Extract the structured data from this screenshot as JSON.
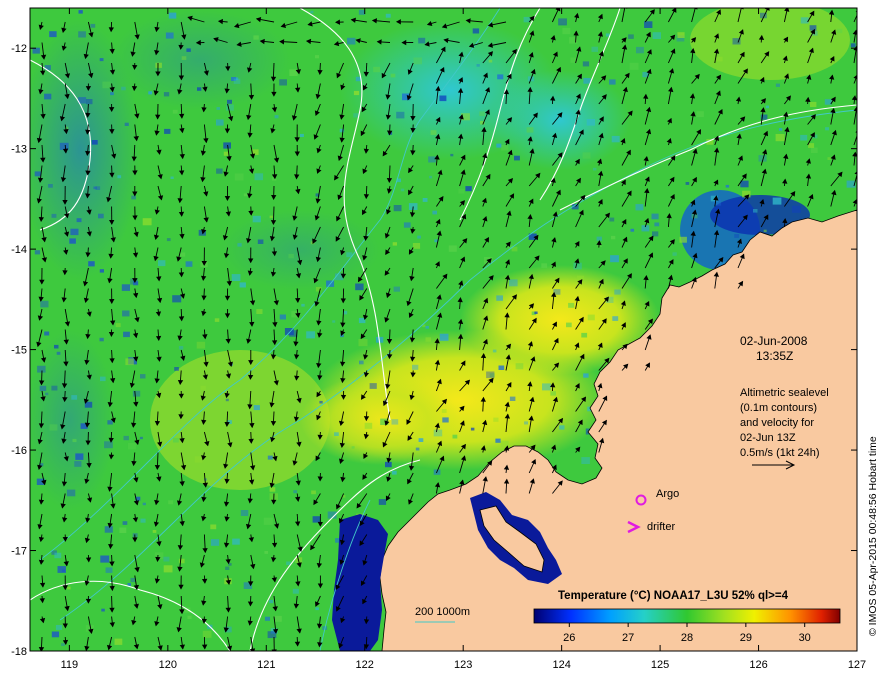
{
  "map": {
    "date": "02-Jun-2008",
    "time": "13:35Z",
    "altimetry_lines": [
      "Altimetric sealevel",
      "(0.1m contours)",
      "and velocity for",
      "02-Jun 13Z"
    ],
    "velocity_scale_label": "0.5m/s (1kt 24h)",
    "argo_label": "Argo",
    "drifter_label": "drifter",
    "depth_legend_label": "200  1000m",
    "colorbar_title": "Temperature (°C) NOAA17_L3U 52% ql>=4",
    "colorbar_ticks": [
      "26",
      "27",
      "28",
      "29",
      "30"
    ],
    "credit": "© IMOS 05-Apr-2015 00:48:56 Hobart time",
    "x_ticks": [
      "119",
      "120",
      "121",
      "122",
      "123",
      "124",
      "125",
      "126",
      "127"
    ],
    "y_ticks": [
      "-12",
      "-13",
      "-14",
      "-15",
      "-16",
      "-17",
      "-18"
    ],
    "colors": {
      "land": "#f9c9a0",
      "warm_patch": "#e6e41a",
      "sea_base": "#3ec93e",
      "cool_patch": "#35c6c6",
      "cold_coastal": "#0a1a9a",
      "argo_marker": "#e01ce0",
      "drifter_marker": "#e01ce0",
      "isobath": "#41c9c9",
      "sla_contour": "#ffffff"
    }
  }
}
